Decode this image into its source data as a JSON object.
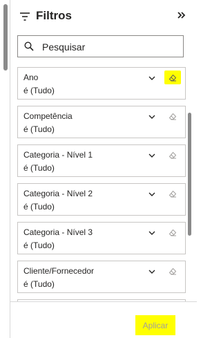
{
  "header": {
    "title": "Filtros",
    "filter_icon": "funnel-icon",
    "collapse_icon": "double-chevron-right-icon"
  },
  "search": {
    "placeholder": "Pesquisar",
    "icon": "search-icon"
  },
  "filters": [
    {
      "name": "Ano",
      "value": "é (Tudo)",
      "highlighted": true
    },
    {
      "name": "Competência",
      "value": "é (Tudo)"
    },
    {
      "name": "Categoria - Nível 1",
      "value": "é (Tudo)"
    },
    {
      "name": "Categoria - Nível 2",
      "value": "é (Tudo)"
    },
    {
      "name": "Categoria - Nível 3",
      "value": "é (Tudo)"
    },
    {
      "name": "Cliente/Fornecedor",
      "value": "é (Tudo)"
    }
  ],
  "footer": {
    "apply_label": "Aplicar"
  },
  "colors": {
    "highlight": "#ffff00",
    "border": "#c8c6c4",
    "text": "#252423",
    "disabled_text": "#a19f9d"
  }
}
